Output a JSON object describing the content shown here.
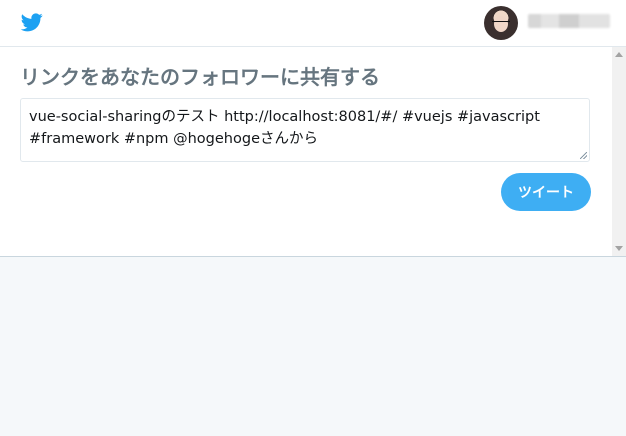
{
  "header": {
    "logo_icon": "twitter-bird-icon",
    "avatar_icon": "user-avatar",
    "username_blurred": true
  },
  "share": {
    "heading": "リンクをあなたのフォロワーに共有する",
    "tweet_text": "vue-social-sharingのテスト http://localhost:8081/#/ #vuejs #javascript #framework #npm @hogehogeさんから",
    "tweet_button_label": "ツイート"
  },
  "colors": {
    "brand": "#1da1f2",
    "heading": "#66757f",
    "page_background": "#f5f8fa"
  }
}
